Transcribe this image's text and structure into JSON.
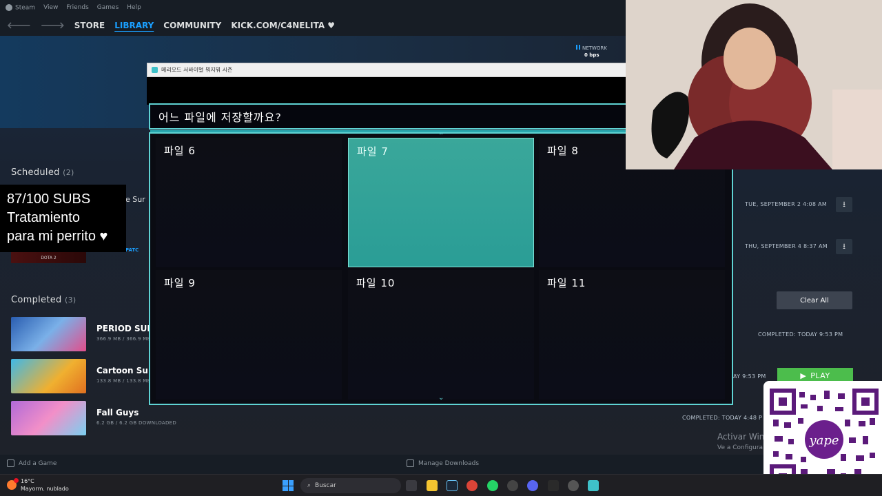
{
  "menubar": {
    "items": [
      "Steam",
      "View",
      "Friends",
      "Games",
      "Help"
    ]
  },
  "navbar": {
    "tabs": [
      "STORE",
      "LIBRARY",
      "COMMUNITY",
      "KICK.COM/C4NELITA ♥"
    ]
  },
  "network": {
    "label": "NETWORK",
    "value": "0 bps"
  },
  "scheduled": {
    "title": "Scheduled",
    "count": "(2)",
    "partial_name": "e Sur",
    "patch_label": "PATC",
    "dota_label": "DOTA 2"
  },
  "completed": {
    "title": "Completed",
    "count": "(3)",
    "games": [
      {
        "name": "PERIOD SURV",
        "size": "366.9 MB / 366.9 MB"
      },
      {
        "name": "Cartoon Surv",
        "size": "133.8 MB / 133.8 MB"
      },
      {
        "name": "Fall Guys",
        "size": "6.2 GB / 6.2 GB DOWNLOADED"
      }
    ]
  },
  "right_panel": {
    "scheduled_times": [
      "TUE, SEPTEMBER 2 4:08 AM",
      "THU, SEPTEMBER 4 8:37 AM"
    ],
    "clear_all": "Clear All",
    "completed_1": "COMPLETED: TODAY 9:53 PM",
    "completed_2_partial": "AY 9:53 PM",
    "play": "PLAY",
    "completed_3": "COMPLETED: TODAY 4:48 P"
  },
  "bottom_bar": {
    "add_game": "Add a Game",
    "manage_downloads": "Manage Downloads"
  },
  "activate_windows": {
    "title": "Activar Win",
    "subtitle": "Ve a Configura"
  },
  "game": {
    "window_title": "메리오드 서바이벌 뭐지뭐 시즌",
    "prompt": "어느 파일에 저장할까요?",
    "slots": [
      {
        "label": "파일 6",
        "selected": false
      },
      {
        "label": "파일 7",
        "selected": true
      },
      {
        "label": "파일 8",
        "selected": false
      },
      {
        "label": "파일 9",
        "selected": false
      },
      {
        "label": "파일 10",
        "selected": false
      },
      {
        "label": "파일 11",
        "selected": false
      }
    ]
  },
  "overlay": {
    "line1": "87/100 SUBS",
    "line2": "Tratamiento",
    "line3": "para mi perrito ♥"
  },
  "taskbar": {
    "temp": "16°C",
    "weather": "Mayorm. nublado",
    "search_placeholder": "Buscar"
  },
  "colors": {
    "steam_accent": "#1a9fff",
    "game_border": "#5fd3d3",
    "selected_slot": "#3aa79a",
    "play_green": "#4cbd4c"
  }
}
